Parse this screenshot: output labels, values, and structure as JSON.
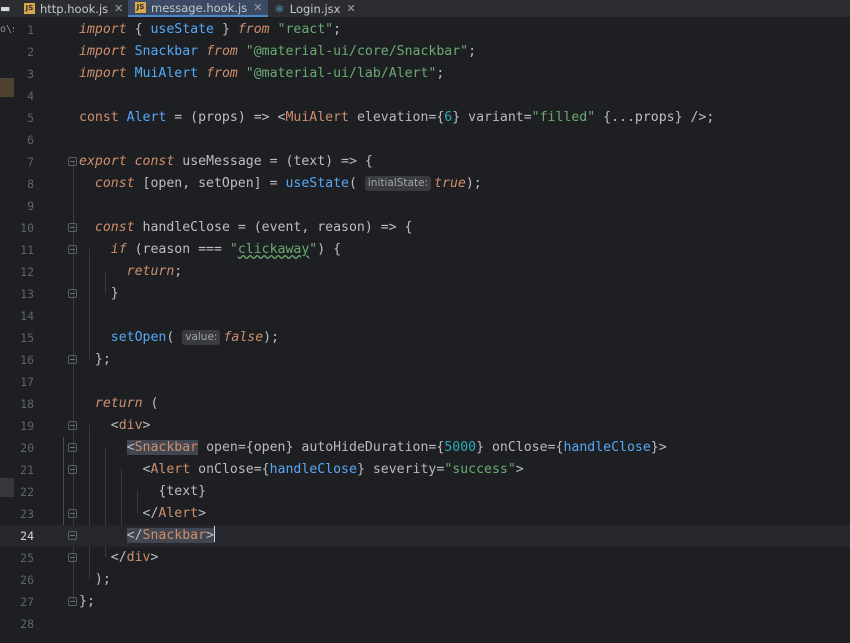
{
  "tabs": [
    {
      "label": "http.hook.js",
      "icon": "js-file-icon",
      "badge": "JS"
    },
    {
      "label": "message.hook.js",
      "icon": "js-file-icon",
      "badge": "JS",
      "active": true
    },
    {
      "label": "Login.jsx",
      "icon": "react-file-icon"
    }
  ],
  "side_strip_text": "o\\s",
  "editor": {
    "current_line": 24,
    "lines": [
      {
        "n": 1,
        "text": "import { useState } from \"react\";"
      },
      {
        "n": 2,
        "text": "import Snackbar from \"@material-ui/core/Snackbar\";"
      },
      {
        "n": 3,
        "text": "import MuiAlert from \"@material-ui/lab/Alert\";"
      },
      {
        "n": 4,
        "text": ""
      },
      {
        "n": 5,
        "text": "const Alert = (props) => <MuiAlert elevation={6} variant=\"filled\" {...props} />;"
      },
      {
        "n": 6,
        "text": ""
      },
      {
        "n": 7,
        "text": "export const useMessage = (text) => {"
      },
      {
        "n": 8,
        "text": "  const [open, setOpen] = useState( true);",
        "hint": "initialState:"
      },
      {
        "n": 9,
        "text": ""
      },
      {
        "n": 10,
        "text": "  const handleClose = (event, reason) => {"
      },
      {
        "n": 11,
        "text": "    if (reason === \"clickaway\") {"
      },
      {
        "n": 12,
        "text": "      return;"
      },
      {
        "n": 13,
        "text": "    }"
      },
      {
        "n": 14,
        "text": ""
      },
      {
        "n": 15,
        "text": "    setOpen( false);",
        "hint": "value:"
      },
      {
        "n": 16,
        "text": "  };"
      },
      {
        "n": 17,
        "text": ""
      },
      {
        "n": 18,
        "text": "  return ("
      },
      {
        "n": 19,
        "text": "    <div>"
      },
      {
        "n": 20,
        "text": "      <Snackbar open={open} autoHideDuration={5000} onClose={handleClose}>"
      },
      {
        "n": 21,
        "text": "        <Alert onClose={handleClose} severity=\"success\">"
      },
      {
        "n": 22,
        "text": "          {text}"
      },
      {
        "n": 23,
        "text": "        </Alert>"
      },
      {
        "n": 24,
        "text": "      </Snackbar>"
      },
      {
        "n": 25,
        "text": "    </div>"
      },
      {
        "n": 26,
        "text": "  );"
      },
      {
        "n": 27,
        "text": "};"
      },
      {
        "n": 28,
        "text": ""
      }
    ]
  }
}
